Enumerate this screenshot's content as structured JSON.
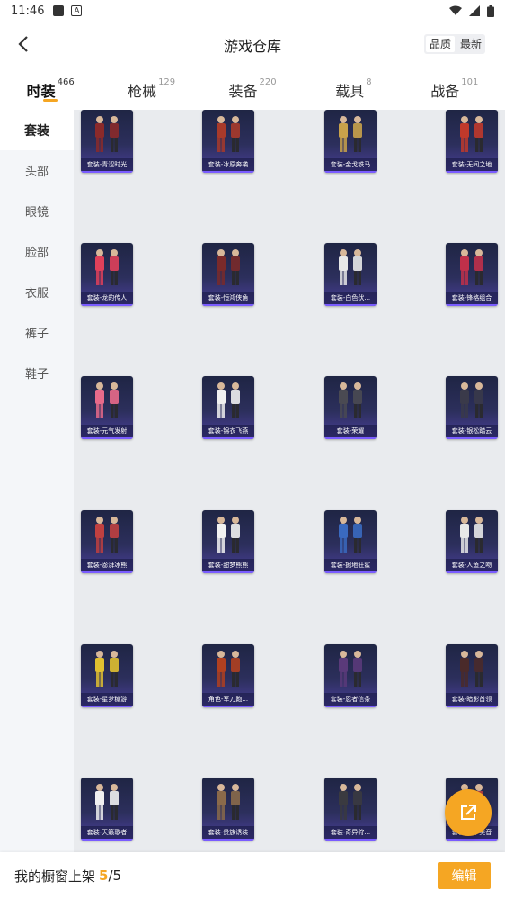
{
  "status_bar": {
    "time": "11:46"
  },
  "header": {
    "title": "游戏仓库",
    "sort_quality": "品质",
    "sort_newest": "最新"
  },
  "tabs": [
    {
      "label": "时装",
      "count": "466",
      "active": true
    },
    {
      "label": "枪械",
      "count": "129",
      "active": false
    },
    {
      "label": "装备",
      "count": "220",
      "active": false
    },
    {
      "label": "载具",
      "count": "8",
      "active": false
    },
    {
      "label": "战备",
      "count": "101",
      "active": false
    }
  ],
  "sidebar": {
    "items": [
      {
        "label": "套装",
        "active": true
      },
      {
        "label": "头部",
        "active": false
      },
      {
        "label": "眼镜",
        "active": false
      },
      {
        "label": "脸部",
        "active": false
      },
      {
        "label": "衣服",
        "active": false
      },
      {
        "label": "裤子",
        "active": false
      },
      {
        "label": "鞋子",
        "active": false
      }
    ]
  },
  "items": [
    {
      "caption": "套装-青涩时光",
      "color": "#8b2a2a"
    },
    {
      "caption": "套装-冰原奔袭",
      "color": "#a83a2a"
    },
    {
      "caption": "套装-金戈铁马",
      "color": "#c9a24a"
    },
    {
      "caption": "套装-无间之地",
      "color": "#c0392b"
    },
    {
      "caption": "套装-龙的传人",
      "color": "#e0405a"
    },
    {
      "caption": "套装-恒鸿侠角",
      "color": "#7a2a2a"
    },
    {
      "caption": "套装-白色伏...",
      "color": "#e8e8e8"
    },
    {
      "caption": "套装-锋格组合",
      "color": "#c0304a"
    },
    {
      "caption": "套装-元气发射",
      "color": "#e86a8a"
    },
    {
      "caption": "套装-锦衣飞燕",
      "color": "#f0f0f0"
    },
    {
      "caption": "套装-荣耀",
      "color": "#4a4a52"
    },
    {
      "caption": "套装-银松踏云",
      "color": "#3a3a4a"
    },
    {
      "caption": "套装-澎湃冰熊",
      "color": "#c04040"
    },
    {
      "caption": "套装-甜梦熊熊",
      "color": "#f2f2f2"
    },
    {
      "caption": "套装-掘地狂鲨",
      "color": "#3a6ac0"
    },
    {
      "caption": "套装-人鱼之吻",
      "color": "#e8e8e8"
    },
    {
      "caption": "套装-星梦糖游",
      "color": "#e0c030"
    },
    {
      "caption": "角色-军刀跑...",
      "color": "#b04020"
    },
    {
      "caption": "套装-忍者信条",
      "color": "#5a3a7a"
    },
    {
      "caption": "套装-暗影首领",
      "color": "#4a2a2a"
    },
    {
      "caption": "套装-天籁歌者",
      "color": "#f0f0f0"
    },
    {
      "caption": "套装-贵族诱装",
      "color": "#8a6a4a"
    },
    {
      "caption": "套装-奇异狩...",
      "color": "#3a3a40"
    },
    {
      "caption": "套装-浮华美音",
      "color": "#c04040"
    }
  ],
  "bottom_bar": {
    "text": "我的橱窗上架",
    "current": "5",
    "separator": "/",
    "total": "5",
    "edit_label": "编辑"
  },
  "colors": {
    "accent": "#f5a623",
    "card_bg": "#2c2f5c",
    "sidebar_bg": "#f4f6f9",
    "grid_bg": "#e9ebee"
  },
  "icons": {
    "back": "chevron-left-icon",
    "share": "external-link-icon",
    "wifi": "wifi-icon",
    "battery": "battery-icon"
  }
}
